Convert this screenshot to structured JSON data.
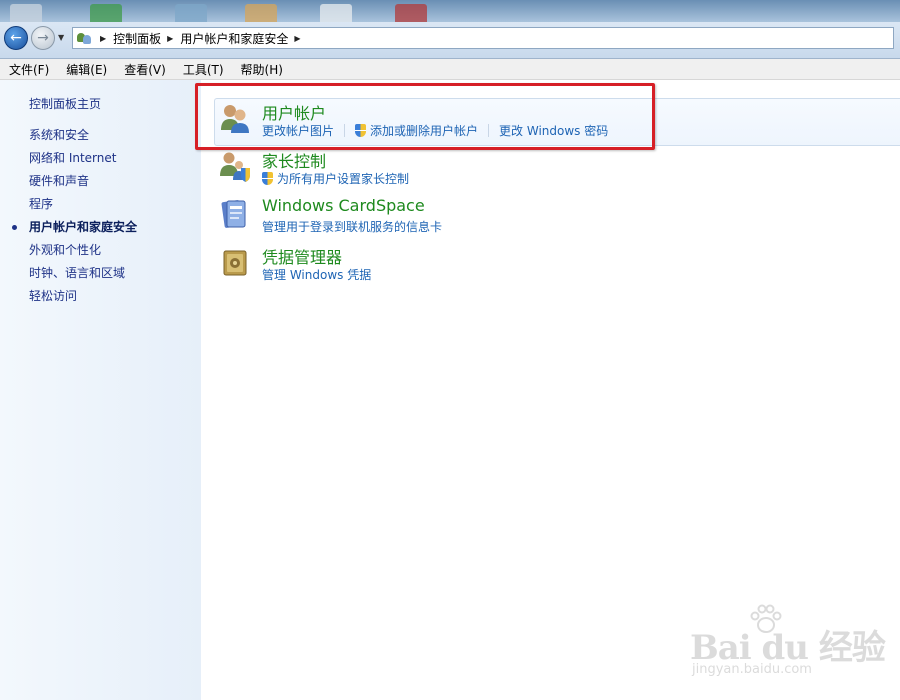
{
  "address_bar": {
    "breadcrumbs": [
      "控制面板",
      "用户帐户和家庭安全"
    ]
  },
  "menu": {
    "items": [
      "文件(F)",
      "编辑(E)",
      "查看(V)",
      "工具(T)",
      "帮助(H)"
    ]
  },
  "left_pane": {
    "home_label": "控制面板主页",
    "items": [
      {
        "label": "系统和安全",
        "active": false
      },
      {
        "label": "网络和 Internet",
        "active": false
      },
      {
        "label": "硬件和声音",
        "active": false
      },
      {
        "label": "程序",
        "active": false
      },
      {
        "label": "用户帐户和家庭安全",
        "active": true
      },
      {
        "label": "外观和个性化",
        "active": false
      },
      {
        "label": "时钟、语言和区域",
        "active": false
      },
      {
        "label": "轻松访问",
        "active": false
      }
    ]
  },
  "categories": [
    {
      "title": "用户帐户",
      "icon": "user-accounts-icon",
      "links": [
        {
          "label": "更改帐户图片",
          "shield": false
        },
        {
          "label": "添加或删除用户帐户",
          "shield": true
        },
        {
          "label": "更改 Windows 密码",
          "shield": false
        }
      ]
    },
    {
      "title": "家长控制",
      "icon": "parental-controls-icon",
      "links": [
        {
          "label": "为所有用户设置家长控制",
          "shield": true
        }
      ]
    },
    {
      "title": "Windows CardSpace",
      "icon": "cardspace-icon",
      "links": [
        {
          "label": "管理用于登录到联机服务的信息卡",
          "shield": false
        }
      ]
    },
    {
      "title": "凭据管理器",
      "icon": "credential-manager-icon",
      "links": [
        {
          "label": "管理 Windows 凭据",
          "shield": false
        }
      ]
    }
  ],
  "annotation": {
    "color": "#d61f26"
  },
  "watermark": {
    "logo": "Bai du 经验",
    "url": "jingyan.baidu.com"
  },
  "colors": {
    "title_green": "#1e8a1e",
    "link_blue": "#1e64b4",
    "nav_text": "#1e3287"
  }
}
